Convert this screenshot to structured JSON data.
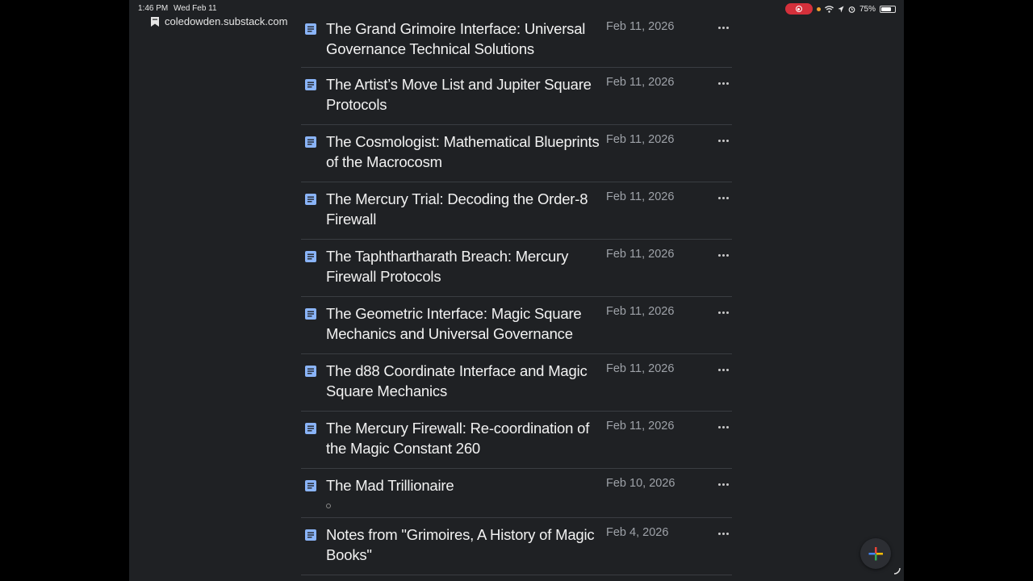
{
  "status_bar": {
    "time": "1:46 PM",
    "date": "Wed Feb 11",
    "battery": "75%",
    "battery_level": 0.75,
    "icons": [
      "screen-record-icon",
      "wifi-icon",
      "location-icon",
      "alarm-icon",
      "battery-icon"
    ]
  },
  "browser": {
    "url": "coledowden.substack.com",
    "url_icon": "bookmark-icon"
  },
  "posts": [
    {
      "title": "The Grand Grimoire Interface: Universal Governance Technical Solutions",
      "date": "Feb 11, 2026"
    },
    {
      "title": "The Artist’s Move List and Jupiter Square Protocols",
      "date": "Feb 11, 2026"
    },
    {
      "title": "The Cosmologist: Mathematical Blueprints of the Macrocosm",
      "date": "Feb 11, 2026"
    },
    {
      "title": "The Mercury Trial: Decoding the Order-8 Firewall",
      "date": "Feb 11, 2026"
    },
    {
      "title": "The Taphthartharath Breach: Mercury Firewall Protocols",
      "date": "Feb 11, 2026"
    },
    {
      "title": "The Geometric Interface: Magic Square Mechanics and Universal Governance",
      "date": "Feb 11, 2026"
    },
    {
      "title": "The d88 Coordinate Interface and Magic Square Mechanics",
      "date": "Feb 11, 2026"
    },
    {
      "title": "The Mercury Firewall: Re-coordination of the Magic Constant 260",
      "date": "Feb 11, 2026"
    },
    {
      "title": "The Mad Trillionaire",
      "date": "Feb 10, 2026"
    },
    {
      "title": "Notes from \"Grimoires, A History of Magic Books\"",
      "date": "Feb 4, 2026"
    }
  ],
  "colors": {
    "background": "#1f2124",
    "doc_icon": "#8ab4f8",
    "divider": "#3a3d42",
    "fab_plus": [
      "#4285f4",
      "#ea4335",
      "#fbbc04",
      "#34a853"
    ]
  }
}
